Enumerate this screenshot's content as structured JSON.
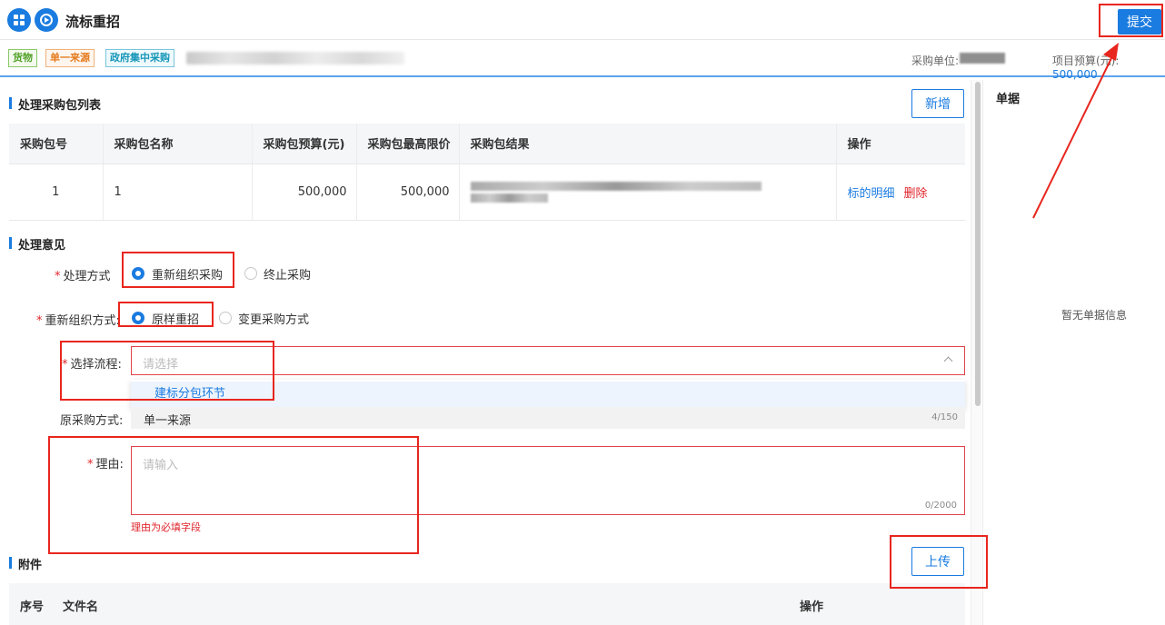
{
  "header": {
    "title": "流标重招",
    "submit_label": "提交"
  },
  "tags": [
    "货物",
    "单一来源",
    "政府集中采购"
  ],
  "info": {
    "unit_label": "采购单位:",
    "budget_label": "项目预算(元):",
    "budget_value": "500,000"
  },
  "package_section": {
    "title": "处理采购包列表",
    "add_label": "新增",
    "columns": [
      "采购包号",
      "采购包名称",
      "采购包预算(元)",
      "采购包最高限价",
      "采购包结果",
      "操作"
    ],
    "rows": [
      {
        "no": "1",
        "name": "1",
        "budget": "500,000",
        "max_price": "500,000",
        "detail_link": "标的明细",
        "delete_link": "删除"
      }
    ]
  },
  "opinion_section": {
    "title": "处理意见",
    "method_label": "处理方式",
    "method_options": [
      "重新组织采购",
      "终止采购"
    ],
    "reorg_label": "重新组织方式:",
    "reorg_options": [
      "原样重招",
      "变更采购方式"
    ],
    "flow_label": "选择流程:",
    "flow_placeholder": "请选择",
    "flow_option": "建标分包环节",
    "orig_label": "原采购方式:",
    "orig_value": "单一来源",
    "orig_count": "4/150",
    "reason_label": "理由:",
    "reason_placeholder": "请输入",
    "reason_count": "0/2000",
    "reason_error": "理由为必填字段"
  },
  "attachment_section": {
    "title": "附件",
    "upload_label": "上传",
    "columns": [
      "序号",
      "文件名",
      "操作"
    ]
  },
  "doc_panel": {
    "title": "单据",
    "empty_text": "暂无单据信息"
  },
  "colors": {
    "primary": "#1a7be0",
    "error": "#e0242a",
    "annotation": "#e8261e"
  }
}
